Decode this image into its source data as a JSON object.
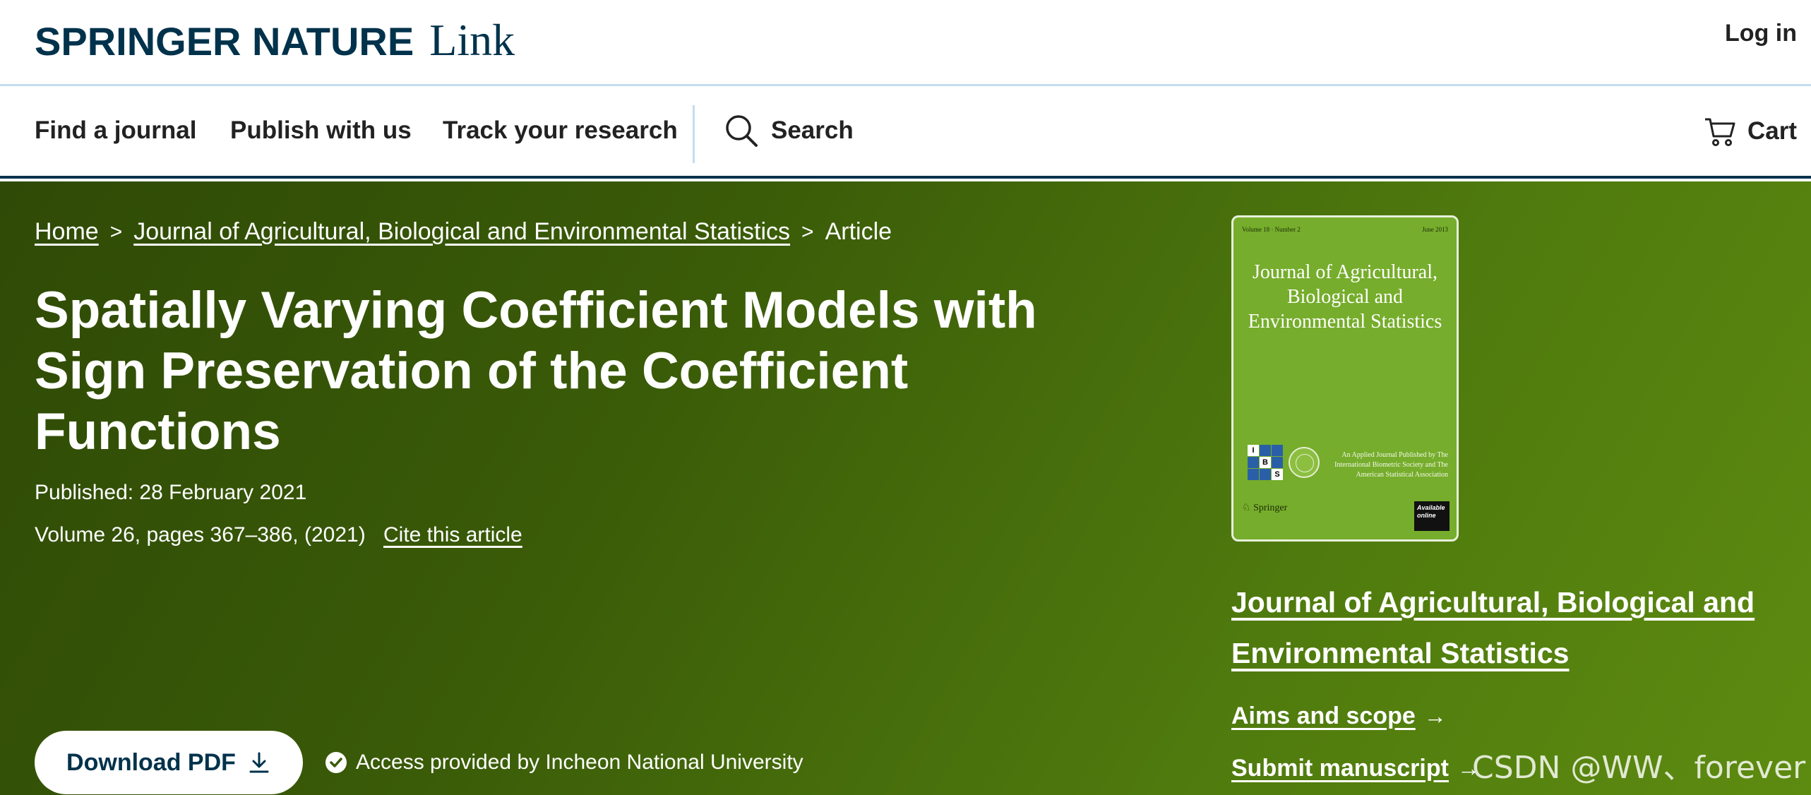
{
  "header": {
    "logo_main": "SPRINGER NATURE",
    "logo_link": "Link",
    "login_label": "Log in"
  },
  "nav": {
    "items": [
      "Find a journal",
      "Publish with us",
      "Track your research"
    ],
    "search_label": "Search",
    "cart_label": "Cart"
  },
  "breadcrumb": {
    "home": "Home",
    "separator": ">",
    "journal": "Journal of Agricultural, Biological and Environmental Statistics",
    "current": "Article"
  },
  "article": {
    "title": "Spatially Varying Coefficient Models with Sign Preservation of the Coefficient Functions",
    "published": "Published: 28 February 2021",
    "volume": "Volume 26, pages 367–386, (2021)",
    "cite_label": "Cite this article"
  },
  "actions": {
    "download_label": "Download PDF",
    "access_text": "Access provided by Incheon National University"
  },
  "cover": {
    "volume_text": "Volume 18 · Number 2",
    "date_text": "June 2013",
    "title": "Journal of Agricultural, Biological and Environmental Statistics",
    "publisher_note": "An Applied Journal Published by The International Biometric Society and The American Statistical Association",
    "springer": "Springer",
    "online_label": "Available online",
    "ibs_letters": [
      "I",
      "B",
      "S"
    ]
  },
  "sidebar": {
    "journal_link": "Journal of Agricultural, Biological and Environmental Statistics",
    "aims_label": "Aims and scope",
    "submit_label": "Submit manuscript",
    "arrow": "→"
  },
  "watermark": "CSDN @WW、forever",
  "colors": {
    "brand_navy": "#01324b",
    "hero_dark": "#2f4a06",
    "hero_light": "#5d8b10",
    "cover_green": "#76ad2c",
    "nav_border_light": "#c6dcef"
  }
}
